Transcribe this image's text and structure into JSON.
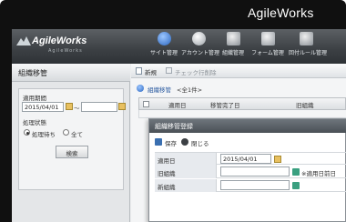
{
  "brand": "AgileWorks",
  "app": {
    "logo_text": "AgileWorks",
    "logo_sub": "AgileWorks",
    "nav": [
      {
        "label": "サイト管理",
        "icon": "site-admin-icon",
        "color": "#4a88d8"
      },
      {
        "label": "アカウント管理",
        "icon": "account-admin-icon",
        "color": "#d0d4d8"
      },
      {
        "label": "組織管理",
        "icon": "org-admin-icon",
        "color": "#c0c4c8"
      },
      {
        "label": "フォーム管理",
        "icon": "form-admin-icon",
        "color": "#c8ccd0"
      },
      {
        "label": "回付ルール管理",
        "icon": "route-rule-icon",
        "color": "#b8bcc0"
      }
    ]
  },
  "left_panel": {
    "title": "組織移管",
    "date_label": "適用期間",
    "date_from": "2015/04/01",
    "date_sep": "～",
    "status_label": "処理状態",
    "radio_pending": "処理待ち",
    "radio_all": "全て",
    "search_button": "検索"
  },
  "right_panel": {
    "new_button": "新規",
    "check_process": "チェック行削除",
    "section_title": "組織移管",
    "section_count": "<全1件>",
    "columns": [
      "適用日",
      "移管完了日",
      "旧組織"
    ]
  },
  "dialog": {
    "title": "組織移管登録",
    "save": "保存",
    "close": "閉じる",
    "rows": [
      {
        "label": "適用日",
        "value": "2015/04/01"
      },
      {
        "label": "旧組織",
        "value": "",
        "note": "※適用日前日"
      },
      {
        "label": "新組織",
        "value": ""
      }
    ]
  }
}
